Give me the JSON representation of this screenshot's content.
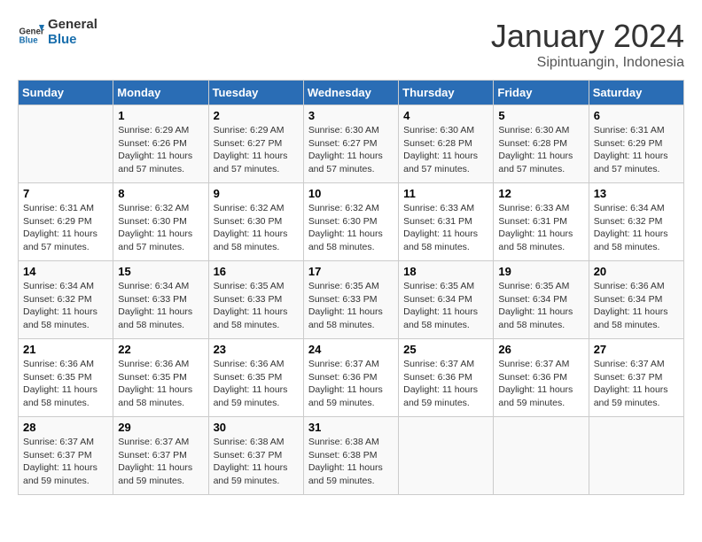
{
  "header": {
    "logo_line1": "General",
    "logo_line2": "Blue",
    "month": "January 2024",
    "location": "Sipintuangin, Indonesia"
  },
  "days_of_week": [
    "Sunday",
    "Monday",
    "Tuesday",
    "Wednesday",
    "Thursday",
    "Friday",
    "Saturday"
  ],
  "weeks": [
    [
      {
        "day": "",
        "info": ""
      },
      {
        "day": "1",
        "info": "Sunrise: 6:29 AM\nSunset: 6:26 PM\nDaylight: 11 hours\nand 57 minutes."
      },
      {
        "day": "2",
        "info": "Sunrise: 6:29 AM\nSunset: 6:27 PM\nDaylight: 11 hours\nand 57 minutes."
      },
      {
        "day": "3",
        "info": "Sunrise: 6:30 AM\nSunset: 6:27 PM\nDaylight: 11 hours\nand 57 minutes."
      },
      {
        "day": "4",
        "info": "Sunrise: 6:30 AM\nSunset: 6:28 PM\nDaylight: 11 hours\nand 57 minutes."
      },
      {
        "day": "5",
        "info": "Sunrise: 6:30 AM\nSunset: 6:28 PM\nDaylight: 11 hours\nand 57 minutes."
      },
      {
        "day": "6",
        "info": "Sunrise: 6:31 AM\nSunset: 6:29 PM\nDaylight: 11 hours\nand 57 minutes."
      }
    ],
    [
      {
        "day": "7",
        "info": "Sunrise: 6:31 AM\nSunset: 6:29 PM\nDaylight: 11 hours\nand 57 minutes."
      },
      {
        "day": "8",
        "info": "Sunrise: 6:32 AM\nSunset: 6:30 PM\nDaylight: 11 hours\nand 57 minutes."
      },
      {
        "day": "9",
        "info": "Sunrise: 6:32 AM\nSunset: 6:30 PM\nDaylight: 11 hours\nand 58 minutes."
      },
      {
        "day": "10",
        "info": "Sunrise: 6:32 AM\nSunset: 6:30 PM\nDaylight: 11 hours\nand 58 minutes."
      },
      {
        "day": "11",
        "info": "Sunrise: 6:33 AM\nSunset: 6:31 PM\nDaylight: 11 hours\nand 58 minutes."
      },
      {
        "day": "12",
        "info": "Sunrise: 6:33 AM\nSunset: 6:31 PM\nDaylight: 11 hours\nand 58 minutes."
      },
      {
        "day": "13",
        "info": "Sunrise: 6:34 AM\nSunset: 6:32 PM\nDaylight: 11 hours\nand 58 minutes."
      }
    ],
    [
      {
        "day": "14",
        "info": "Sunrise: 6:34 AM\nSunset: 6:32 PM\nDaylight: 11 hours\nand 58 minutes."
      },
      {
        "day": "15",
        "info": "Sunrise: 6:34 AM\nSunset: 6:33 PM\nDaylight: 11 hours\nand 58 minutes."
      },
      {
        "day": "16",
        "info": "Sunrise: 6:35 AM\nSunset: 6:33 PM\nDaylight: 11 hours\nand 58 minutes."
      },
      {
        "day": "17",
        "info": "Sunrise: 6:35 AM\nSunset: 6:33 PM\nDaylight: 11 hours\nand 58 minutes."
      },
      {
        "day": "18",
        "info": "Sunrise: 6:35 AM\nSunset: 6:34 PM\nDaylight: 11 hours\nand 58 minutes."
      },
      {
        "day": "19",
        "info": "Sunrise: 6:35 AM\nSunset: 6:34 PM\nDaylight: 11 hours\nand 58 minutes."
      },
      {
        "day": "20",
        "info": "Sunrise: 6:36 AM\nSunset: 6:34 PM\nDaylight: 11 hours\nand 58 minutes."
      }
    ],
    [
      {
        "day": "21",
        "info": "Sunrise: 6:36 AM\nSunset: 6:35 PM\nDaylight: 11 hours\nand 58 minutes."
      },
      {
        "day": "22",
        "info": "Sunrise: 6:36 AM\nSunset: 6:35 PM\nDaylight: 11 hours\nand 58 minutes."
      },
      {
        "day": "23",
        "info": "Sunrise: 6:36 AM\nSunset: 6:35 PM\nDaylight: 11 hours\nand 59 minutes."
      },
      {
        "day": "24",
        "info": "Sunrise: 6:37 AM\nSunset: 6:36 PM\nDaylight: 11 hours\nand 59 minutes."
      },
      {
        "day": "25",
        "info": "Sunrise: 6:37 AM\nSunset: 6:36 PM\nDaylight: 11 hours\nand 59 minutes."
      },
      {
        "day": "26",
        "info": "Sunrise: 6:37 AM\nSunset: 6:36 PM\nDaylight: 11 hours\nand 59 minutes."
      },
      {
        "day": "27",
        "info": "Sunrise: 6:37 AM\nSunset: 6:37 PM\nDaylight: 11 hours\nand 59 minutes."
      }
    ],
    [
      {
        "day": "28",
        "info": "Sunrise: 6:37 AM\nSunset: 6:37 PM\nDaylight: 11 hours\nand 59 minutes."
      },
      {
        "day": "29",
        "info": "Sunrise: 6:37 AM\nSunset: 6:37 PM\nDaylight: 11 hours\nand 59 minutes."
      },
      {
        "day": "30",
        "info": "Sunrise: 6:38 AM\nSunset: 6:37 PM\nDaylight: 11 hours\nand 59 minutes."
      },
      {
        "day": "31",
        "info": "Sunrise: 6:38 AM\nSunset: 6:38 PM\nDaylight: 11 hours\nand 59 minutes."
      },
      {
        "day": "",
        "info": ""
      },
      {
        "day": "",
        "info": ""
      },
      {
        "day": "",
        "info": ""
      }
    ]
  ]
}
